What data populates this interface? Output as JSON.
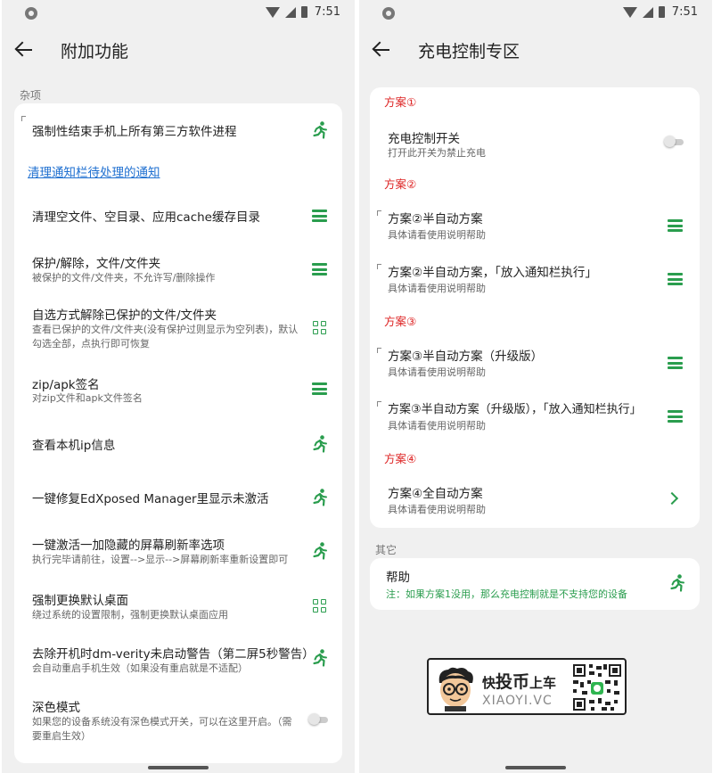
{
  "status_bar": {
    "time": "7:51"
  },
  "colors": {
    "accent_green": "#2a9d4e",
    "plan_red": "#dd2222",
    "link_blue": "#1e6fd0"
  },
  "left_screen": {
    "title": "附加功能",
    "section_label": "杂项",
    "items": [
      {
        "title": "强制性结束手机上所有第三方软件进程",
        "subtitle": "",
        "icon": "run-icon"
      },
      {
        "title": "清理通知栏待处理的通知",
        "subtitle": "",
        "icon": "",
        "link": true
      },
      {
        "title": "清理空文件、空目录、应用cache缓存目录",
        "subtitle": "",
        "icon": "menu-icon"
      },
      {
        "title": "保护/解除，文件/文件夹",
        "subtitle": "被保护的文件/文件夹，不允许写/删除操作",
        "icon": "menu-icon"
      },
      {
        "title": "自选方式解除已保护的文件/文件夹",
        "subtitle": "查看已保护的文件/文件夹(没有保护过则显示为空列表)，默认勾选全部，点执行即可恢复",
        "icon": "grid-icon"
      },
      {
        "title": "zip/apk签名",
        "subtitle": "对zip文件和apk文件签名",
        "icon": "menu-icon"
      },
      {
        "title": "查看本机ip信息",
        "subtitle": "",
        "icon": "run-icon"
      },
      {
        "title": "一键修复EdXposed Manager里显示未激活",
        "subtitle": "",
        "icon": "run-icon"
      },
      {
        "title": "一键激活一加隐藏的屏幕刷新率选项",
        "subtitle": "执行完毕请前往，设置-->显示-->屏幕刷新率重新设置即可",
        "icon": "run-icon"
      },
      {
        "title": "强制更换默认桌面",
        "subtitle": "绕过系统的设置限制，强制更换默认桌面应用",
        "icon": "grid-icon"
      },
      {
        "title": "去除开机时dm-verity未启动警告（第二屏5秒警告）",
        "subtitle": "会自动重启手机生效（如果没有重启就是不适配）",
        "icon": "run-icon"
      },
      {
        "title": "深色模式",
        "subtitle": "如果您的设备系统没有深色模式开关，可以在这里开启。（需要重启生效）",
        "icon": "toggle"
      }
    ]
  },
  "right_screen": {
    "title": "充电控制专区",
    "plans": {
      "p1": "方案①",
      "p2": "方案②",
      "p3": "方案③",
      "p4": "方案④"
    },
    "items": [
      {
        "title": "充电控制开关",
        "subtitle": "打开此开关为禁止充电",
        "icon": "toggle"
      },
      {
        "title": "方案②半自动方案",
        "subtitle": "具体请看使用说明帮助",
        "icon": "menu-icon"
      },
      {
        "title": "方案②半自动方案，「放入通知栏执行」",
        "subtitle": "具体请看使用说明帮助",
        "icon": "menu-icon"
      },
      {
        "title": "方案③半自动方案（升级版）",
        "subtitle": "具体请看使用说明帮助",
        "icon": "menu-icon"
      },
      {
        "title": "方案③半自动方案（升级版），「放入通知栏执行」",
        "subtitle": "具体请看使用说明帮助",
        "icon": "menu-icon"
      },
      {
        "title": "方案④全自动方案",
        "subtitle": "具体请看使用说明帮助",
        "icon": "chevron-right-icon"
      }
    ],
    "other_label": "其它",
    "help": {
      "title": "帮助",
      "note": "注：如果方案1没用，那么充电控制就是不支持您的设备",
      "icon": "run-icon"
    }
  },
  "watermark": {
    "cn_prefix": "快",
    "cn_big": "投币",
    "cn_suffix": "上车",
    "en": "XIAOYI.VC"
  }
}
